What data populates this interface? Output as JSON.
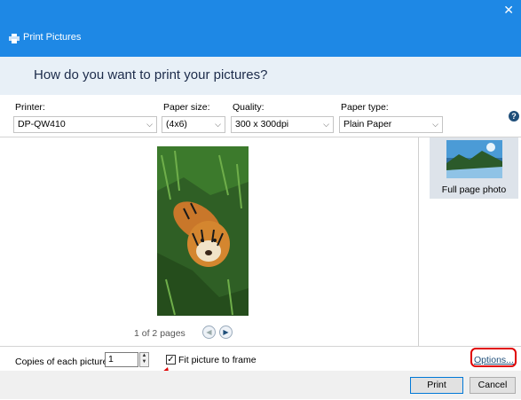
{
  "window": {
    "title": "Print Pictures",
    "close_glyph": "✕"
  },
  "header": {
    "question": "How do you want to print your pictures?"
  },
  "printer": {
    "label": "Printer:",
    "value": "DP-QW410"
  },
  "paper_size": {
    "label": "Paper size:",
    "value": "(4x6)"
  },
  "quality": {
    "label": "Quality:",
    "value": "300 x 300dpi"
  },
  "paper_type": {
    "label": "Paper type:",
    "value": "Plain Paper"
  },
  "chevron": "⌵",
  "help": {
    "glyph": "?"
  },
  "preview": {
    "page_text": "1 of 2 pages",
    "prev_glyph": "◀",
    "next_glyph": "▶"
  },
  "layout": {
    "caption": "Full page photo"
  },
  "copies": {
    "label": "Copies of each picture:",
    "value": "1"
  },
  "spinner": {
    "up": "▲",
    "down": "▼"
  },
  "fit": {
    "label": "Fit picture to frame",
    "check": "✓"
  },
  "options": {
    "label": "Options..."
  },
  "buttons": {
    "print": "Print",
    "cancel": "Cancel"
  },
  "colors": {
    "titlebar": "#1e88e5",
    "header_bg": "#e8f0f7",
    "annotation_red": "#e00000"
  }
}
